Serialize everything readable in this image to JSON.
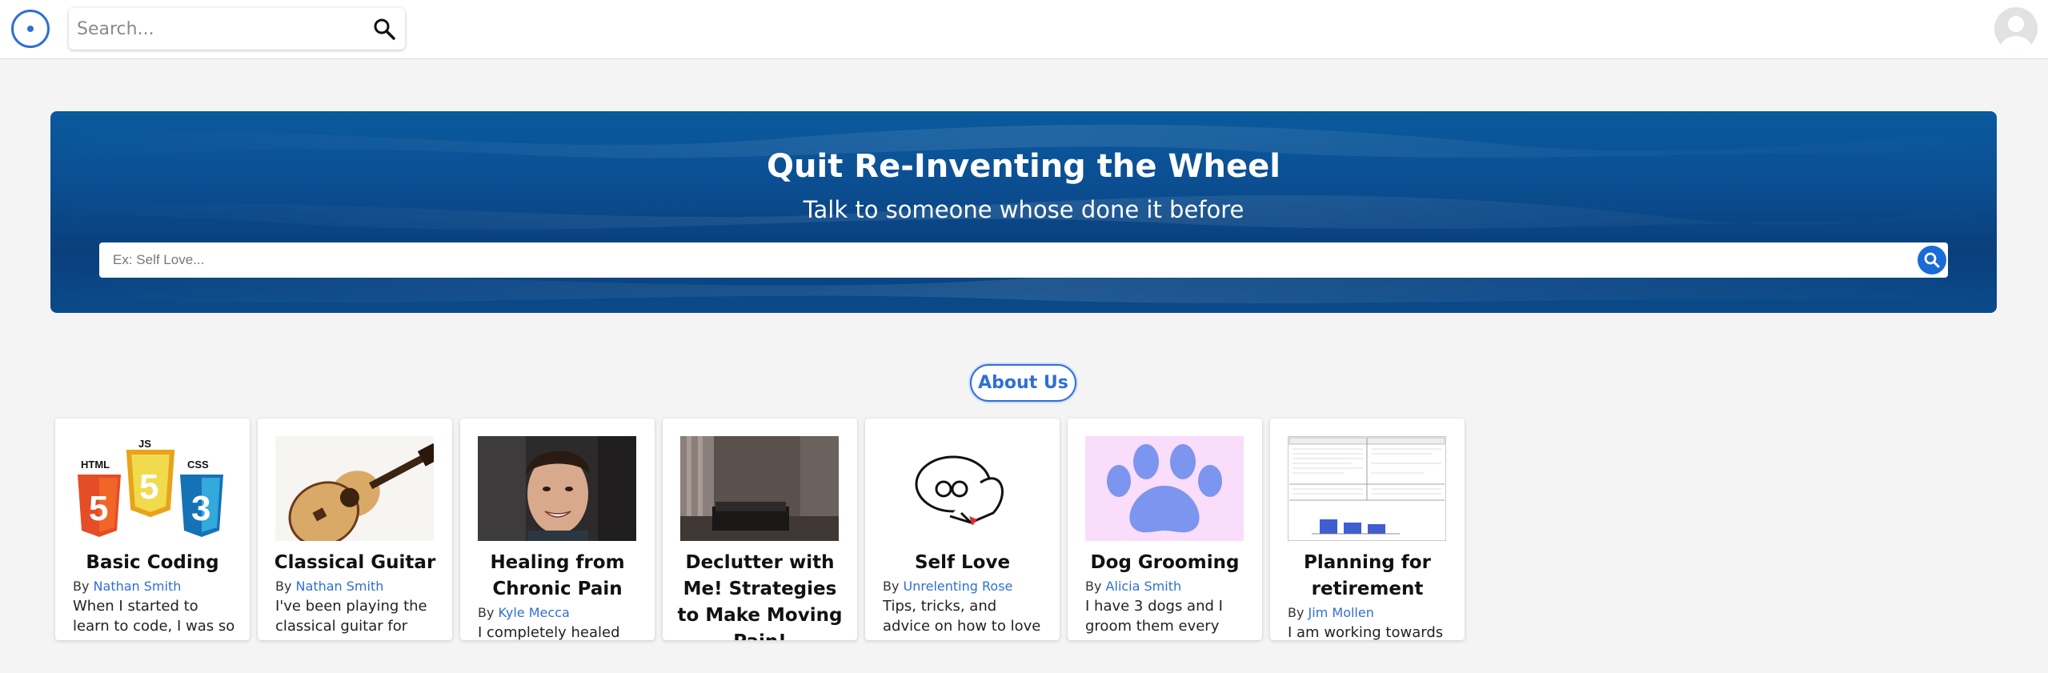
{
  "header": {
    "search_placeholder": "Search..."
  },
  "hero": {
    "title": "Quit Re-Inventing the Wheel",
    "subtitle": "Talk to someone whose done it before",
    "search_placeholder": "Ex: Self Love..."
  },
  "about_label": "About Us",
  "by_label": "By",
  "cards": [
    {
      "title": "Basic Coding",
      "author": "Nathan Smith",
      "desc": "When I started to learn to code, I was so",
      "image": "html-js-css-logos"
    },
    {
      "title": "Classical Guitar",
      "author": "Nathan Smith",
      "desc": "I've been playing the classical guitar for",
      "image": "guitar-photo"
    },
    {
      "title": "Healing from Chronic Pain",
      "author": "Kyle Mecca",
      "desc": "I completely healed",
      "image": "smiling-man-photo"
    },
    {
      "title": "Declutter with Me! Strategies to Make Moving Pain!",
      "author": "",
      "desc": "",
      "image": "bedroom-photo"
    },
    {
      "title": "Self Love",
      "author": "Unrelenting Rose",
      "desc": "Tips, tricks, and advice on how to love",
      "image": "self-hug-cartoon"
    },
    {
      "title": "Dog Grooming",
      "author": "Alicia Smith",
      "desc": "I have 3 dogs and I groom them every",
      "image": "paw-print"
    },
    {
      "title": "Planning for retirement",
      "author": "Jim Mollen",
      "desc": "I am working towards",
      "image": "spreadsheet-document"
    }
  ],
  "colors": {
    "accent": "#2f6fd6",
    "hero_blue": "#0b4f92",
    "paw": "#7c95ee",
    "paw_bg": "#fadcfb"
  }
}
